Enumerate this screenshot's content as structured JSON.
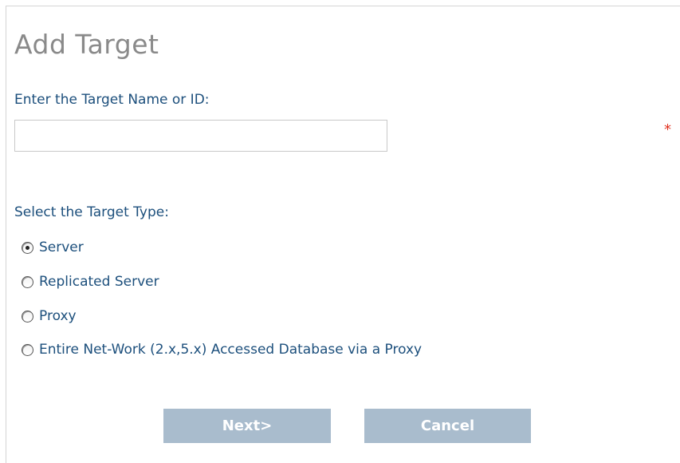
{
  "dialog": {
    "title": "Add Target"
  },
  "target_name": {
    "label": "Enter the Target Name or ID:",
    "value": "",
    "placeholder": "",
    "required_marker": "*"
  },
  "target_type": {
    "label": "Select the Target Type:",
    "selected": "Server",
    "options": [
      {
        "label": "Server",
        "checked": true
      },
      {
        "label": "Replicated Server",
        "checked": false
      },
      {
        "label": "Proxy",
        "checked": false
      },
      {
        "label": "Entire Net-Work (2.x,5.x) Accessed Database via a Proxy",
        "checked": false
      }
    ]
  },
  "buttons": {
    "next_label": "Next>",
    "cancel_label": "Cancel"
  },
  "colors": {
    "title": "#8a8a8a",
    "label": "#1c4f7c",
    "required": "#e0301e",
    "button_bg": "#a9bccd",
    "button_text": "#ffffff"
  }
}
